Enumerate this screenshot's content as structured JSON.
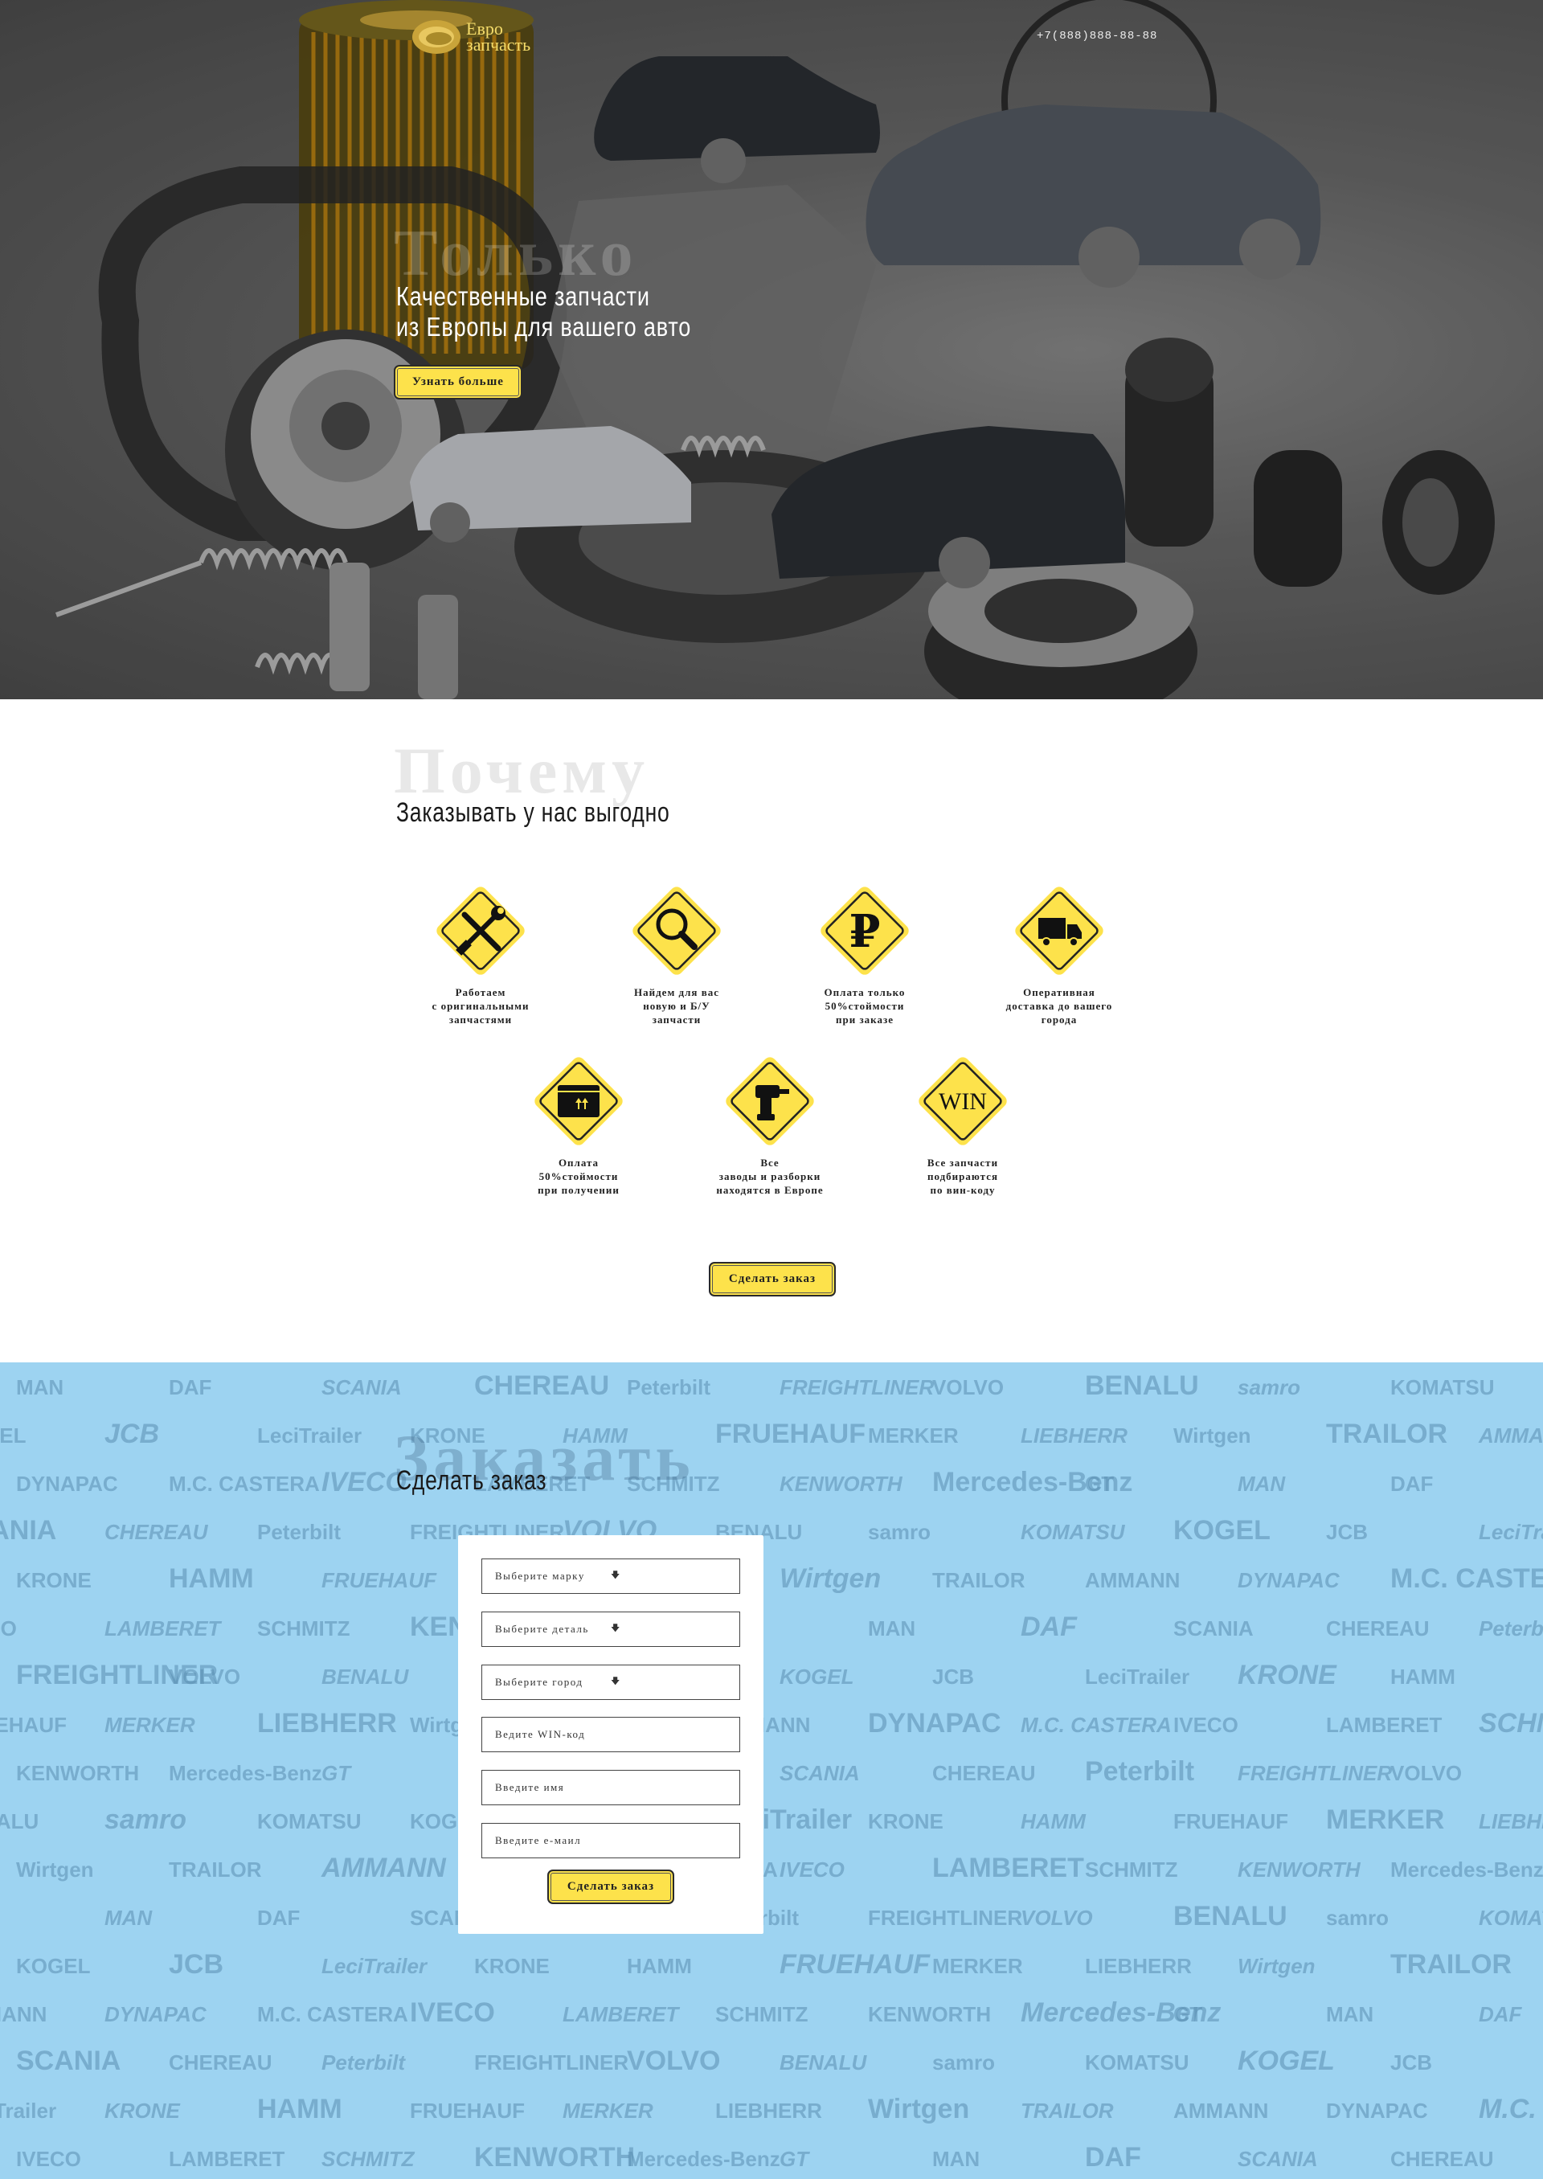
{
  "header": {
    "logo_line1": "Евро",
    "logo_line2": "запчасть",
    "phone": "+7(888)888-88-88"
  },
  "hero": {
    "ghost_word": "Только",
    "title_line1": "Качественные запчасти",
    "title_line2": "из Европы для вашего авто",
    "button_label": "Узнать больше"
  },
  "why": {
    "ghost_word": "Почему",
    "title": "Заказывать у нас выгодно",
    "features": [
      {
        "icon": "tools-icon",
        "caption": "Работаем\nс оригинальными\nзапчастями"
      },
      {
        "icon": "magnifier-icon",
        "caption": "Найдем для вас\nновую и Б/У\nзапчасти"
      },
      {
        "icon": "ruble-icon",
        "caption": "Оплата  только\n50%стоймости\nпри заказе"
      },
      {
        "icon": "truck-icon",
        "caption": "Оперативная\nдоставка до вашего\nгорода"
      },
      {
        "icon": "box-icon",
        "caption": "Оплата\n50%стоймости\nпри получении"
      },
      {
        "icon": "drill-icon",
        "caption": "Все\nзаводы и разборки\nнаходятся в Европе"
      },
      {
        "icon": "win-icon",
        "icon_text": "WIN",
        "caption": "Все запчасти\nподбираются\nпо вин-коду"
      }
    ],
    "button_label": "Сделать заказ"
  },
  "order": {
    "ghost_word": "Заказать",
    "title": "Сделать заказ",
    "selects": [
      {
        "value": "Выберите марку"
      },
      {
        "value": "Выберите деталь"
      },
      {
        "value": "Выберите город"
      }
    ],
    "inputs": [
      {
        "placeholder": "Ведите WIN-код"
      },
      {
        "placeholder": "Введите имя"
      },
      {
        "placeholder": "Введите е-маил"
      }
    ],
    "button_label": "Сделать заказ",
    "brand_logos": [
      "MAN",
      "DAF",
      "SCANIA",
      "CHEREAU",
      "Peterbilt",
      "FREIGHTLINER",
      "VOLVO",
      "BENALU",
      "samro",
      "KOMATSU",
      "KOGEL",
      "JCB",
      "LeciTrailer",
      "KRONE",
      "HAMM",
      "FRUEHAUF",
      "MERKER",
      "LIEBHERR",
      "Wirtgen",
      "TRAILOR",
      "AMMANN",
      "DYNAPAC",
      "M.C. CASTERA",
      "IVECO",
      "LAMBERET",
      "SCHMITZ",
      "KENWORTH",
      "Mercedes-Benz",
      "GT"
    ]
  },
  "colors": {
    "accent_yellow": "#fde24b",
    "order_bg": "#9dd3f1",
    "hero_bg": "#6a6a6a"
  }
}
